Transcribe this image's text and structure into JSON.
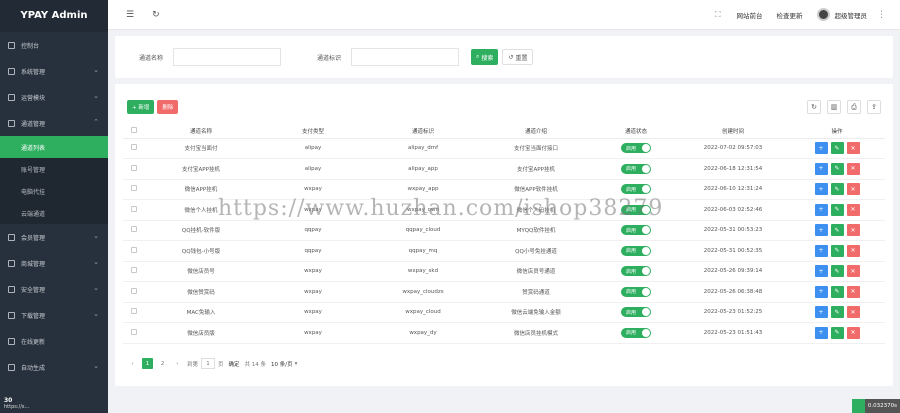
{
  "brand": "YPAY Admin",
  "sidebar": {
    "items": [
      {
        "label": "控制台"
      },
      {
        "label": "系统管理"
      },
      {
        "label": "运营模块"
      },
      {
        "label": "通道管理"
      }
    ],
    "sub_items": [
      {
        "label": "通道列表"
      },
      {
        "label": "账号管理"
      },
      {
        "label": "电脑代挂"
      },
      {
        "label": "云端通道"
      }
    ],
    "items_after": [
      {
        "label": "会员管理"
      },
      {
        "label": "商城管理"
      },
      {
        "label": "安全管理"
      },
      {
        "label": "下载管理"
      },
      {
        "label": "在线更新"
      },
      {
        "label": "自动生成"
      }
    ],
    "footer_value": "30",
    "footer_text": "https://s..."
  },
  "topbar": {
    "links": [
      "网站前台",
      "检查更新"
    ],
    "user": "超级管理员"
  },
  "search": {
    "fields": [
      {
        "label": "通道名称",
        "value": ""
      },
      {
        "label": "通道标识",
        "value": ""
      }
    ],
    "search_label": "搜索",
    "reset_label": "重置"
  },
  "table": {
    "add_label": "+ 新增",
    "delete_label": "删除",
    "headers": [
      "",
      "通道名称",
      "支付类型",
      "通道标识",
      "通道介绍",
      "通道状态",
      "创建时间",
      "操作"
    ],
    "rows": [
      [
        "支付宝当面付",
        "alipay",
        "alipay_dmf",
        "支付宝当面付接口",
        "启用",
        "2022-07-02 09:57:03"
      ],
      [
        "支付宝APP挂机",
        "alipay",
        "alipay_app",
        "支付宝APP挂机",
        "启用",
        "2022-06-18 12:31:54"
      ],
      [
        "微信APP挂机",
        "wxpay",
        "wxpay_app",
        "微信APP软件挂机",
        "启用",
        "2022-06-10 12:31:24"
      ],
      [
        "微信个人挂机",
        "wxpay",
        "wxpay_own",
        "微信个人码挂机",
        "启用",
        "2022-06-03 02:52:46"
      ],
      [
        "QQ挂机-软件版",
        "qqpay",
        "qqpay_cloud",
        "MYQQ软件挂机",
        "启用",
        "2022-05-31 00:53:23"
      ],
      [
        "QQ钱包-小号版",
        "qqpay",
        "qqpay_mq",
        "QQ小号免挂通道",
        "启用",
        "2022-05-31 00:52:35"
      ],
      [
        "微信店员号",
        "wxpay",
        "wxpay_skd",
        "微信店员号通道",
        "启用",
        "2022-05-26 09:39:14"
      ],
      [
        "微信赞赏码",
        "wxpay",
        "wxpay_cloudzs",
        "赞赏码通道",
        "启用",
        "2022-05-26 06:38:48"
      ],
      [
        "MAC免输入",
        "wxpay",
        "wxpay_cloud",
        "微信云端免输入金额",
        "启用",
        "2022-05-23 01:52:25"
      ],
      [
        "微信店员版",
        "wxpay",
        "wxpay_dy",
        "微信店员挂机模式",
        "启用",
        "2022-05-23 01:51:43"
      ]
    ]
  },
  "pager": {
    "pages": [
      "1",
      "2"
    ],
    "next": "›",
    "goto_label": "到第",
    "goto_value": "1",
    "goto_unit": "页",
    "confirm": "确定",
    "total": "共 14 条",
    "per_page": "10 条/页"
  },
  "watermark": "https://www.huzhan.com/ishop38279",
  "timer": "0.032370s"
}
